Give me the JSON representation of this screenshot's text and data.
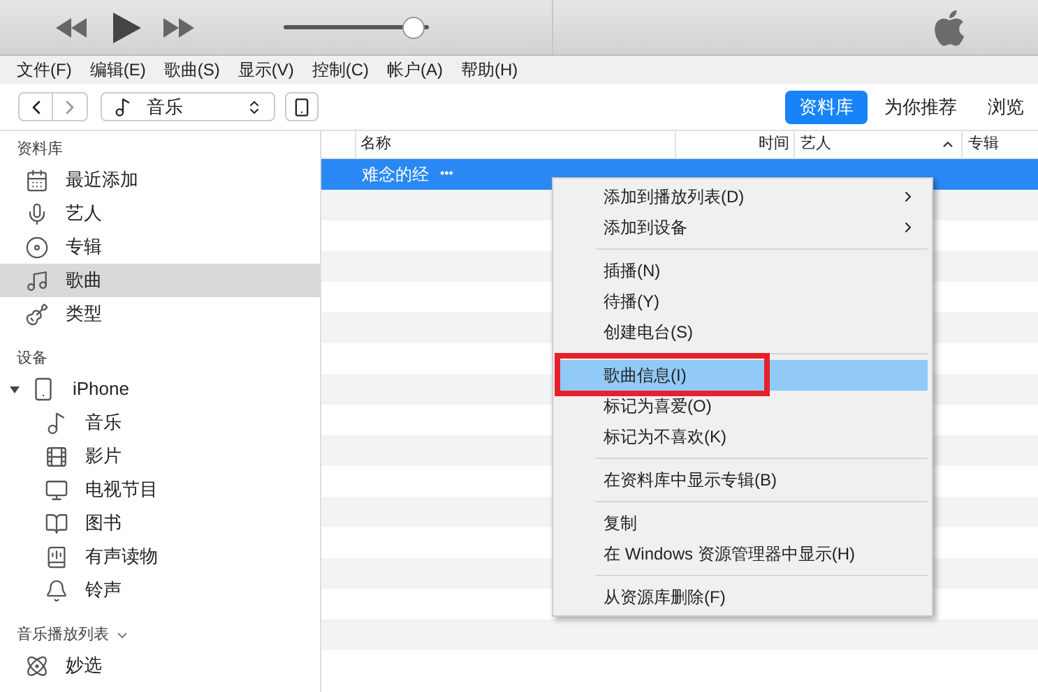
{
  "player": {
    "volume": {
      "level": 0.97
    }
  },
  "menubar": [
    "文件(F)",
    "编辑(E)",
    "歌曲(S)",
    "显示(V)",
    "控制(C)",
    "帐户(A)",
    "帮助(H)"
  ],
  "toolbar": {
    "media_picker": "音乐"
  },
  "nav_tabs": [
    {
      "label": "资料库",
      "selected": true
    },
    {
      "label": "为你推荐",
      "selected": false
    },
    {
      "label": "浏览",
      "selected": false
    }
  ],
  "sidebar": {
    "sections": [
      {
        "title": "资料库",
        "collapsible": false,
        "items": [
          {
            "label": "最近添加",
            "selected": false
          },
          {
            "label": "艺人",
            "selected": false
          },
          {
            "label": "专辑",
            "selected": false
          },
          {
            "label": "歌曲",
            "selected": true
          },
          {
            "label": "类型",
            "selected": false
          }
        ]
      },
      {
        "title": "设备",
        "collapsible": false,
        "items": [
          {
            "label": "iPhone",
            "selected": false,
            "expanded": true,
            "children": [
              {
                "label": "音乐",
                "selected": false
              },
              {
                "label": "影片",
                "selected": false
              },
              {
                "label": "电视节目",
                "selected": false
              },
              {
                "label": "图书",
                "selected": false
              },
              {
                "label": "有声读物",
                "selected": false
              },
              {
                "label": "铃声",
                "selected": false
              }
            ]
          }
        ]
      },
      {
        "title": "音乐播放列表",
        "collapsible": true,
        "items": [
          {
            "label": "妙选",
            "selected": false
          }
        ]
      }
    ]
  },
  "table": {
    "columns": [
      "名称",
      "时间",
      "艺人",
      "专辑"
    ],
    "rows": [
      {
        "name": "难念的经",
        "more": "•••",
        "selected": true
      }
    ]
  },
  "context_menu": [
    {
      "kind": "item",
      "label": "添加到播放列表(D)",
      "submenu": true,
      "selected": false
    },
    {
      "kind": "item",
      "label": "添加到设备",
      "submenu": true,
      "selected": false
    },
    {
      "kind": "separator"
    },
    {
      "kind": "item",
      "label": "插播(N)",
      "submenu": false,
      "selected": false
    },
    {
      "kind": "item",
      "label": "待播(Y)",
      "submenu": false,
      "selected": false
    },
    {
      "kind": "item",
      "label": "创建电台(S)",
      "submenu": false,
      "selected": false
    },
    {
      "kind": "separator"
    },
    {
      "kind": "item",
      "label": "歌曲信息(I)",
      "submenu": false,
      "selected": true
    },
    {
      "kind": "item",
      "label": "标记为喜爱(O)",
      "submenu": false,
      "selected": false
    },
    {
      "kind": "item",
      "label": "标记为不喜欢(K)",
      "submenu": false,
      "selected": false
    },
    {
      "kind": "separator"
    },
    {
      "kind": "item",
      "label": "在资料库中显示专辑(B)",
      "submenu": false,
      "selected": false
    },
    {
      "kind": "separator"
    },
    {
      "kind": "item",
      "label": "复制",
      "submenu": false,
      "selected": false
    },
    {
      "kind": "item",
      "label": "在 Windows 资源管理器中显示(H)",
      "submenu": false,
      "selected": false
    },
    {
      "kind": "separator"
    },
    {
      "kind": "item",
      "label": "从资源库删除(F)",
      "submenu": false,
      "selected": false
    }
  ]
}
